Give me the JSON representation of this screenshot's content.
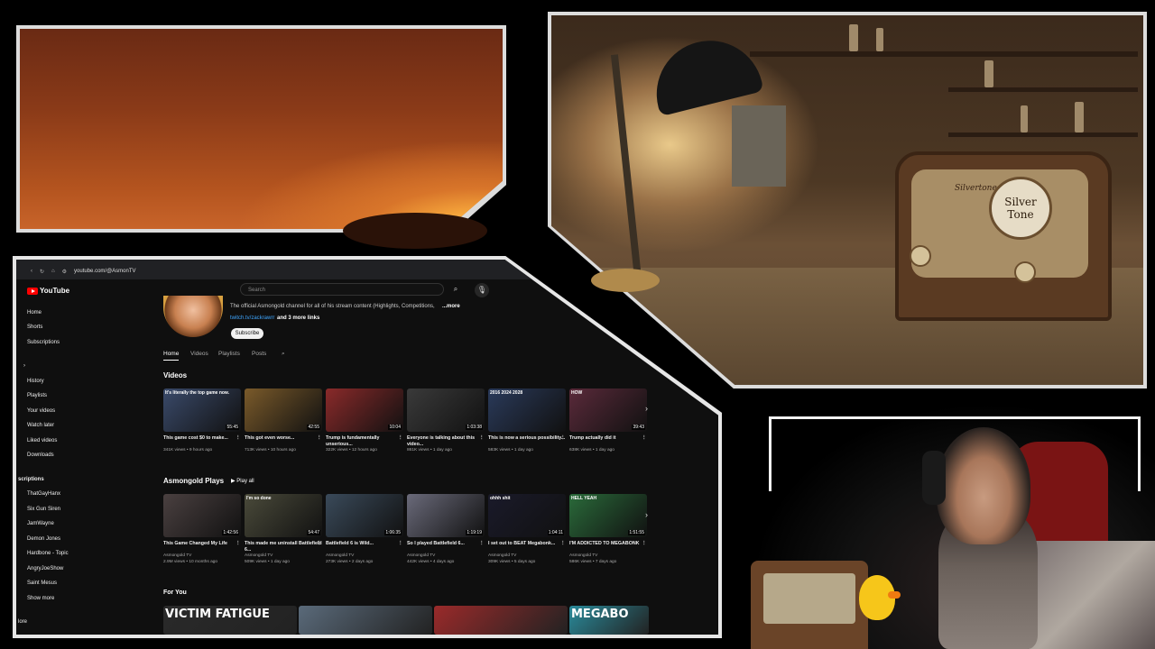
{
  "browser": {
    "url": "youtube.com/@AsmonTV"
  },
  "youtube": {
    "logo_text": "YouTube",
    "search_placeholder": "Search",
    "sidebar": {
      "top": [
        "Home",
        "Shorts",
        "Subscriptions"
      ],
      "you": [
        "History",
        "Playlists",
        "Your videos",
        "Watch later",
        "Liked videos",
        "Downloads"
      ],
      "subscriptions_header": "scriptions",
      "subscriptions": [
        "ThatGayHanx",
        "Six Gun Siren",
        "JamWayne",
        "Demon Jones",
        "Hardbone - Topic",
        "AngryJoeShow",
        "Saint Mesus",
        "Show more"
      ],
      "footer": "lore"
    },
    "channel": {
      "description": "The official Asmongold channel for all of his stream content (Highlights, Competitions,",
      "more": "...more",
      "links_prefix": "twitch.tv/zackrawrr",
      "links_suffix": "and 3 more links",
      "subscribe_label": "Subscribe"
    },
    "tabs": [
      "Home",
      "Videos",
      "Playlists",
      "Posts"
    ],
    "videos_section": {
      "title": "Videos",
      "items": [
        {
          "title": "This game cost $0 to make...",
          "meta": "341K views • 9 hours ago",
          "duration": "55:45",
          "overlay": "It's literally the top game now.",
          "bg": "#3a4a6a"
        },
        {
          "title": "This got even worse...",
          "meta": "713K views • 10 hours ago",
          "duration": "42:55",
          "overlay": "",
          "bg": "#7a5a2a"
        },
        {
          "title": "Trump is fundamentally unserious...",
          "meta": "322K views • 12 hours ago",
          "duration": "10:04",
          "overlay": "",
          "bg": "#8a2a2a"
        },
        {
          "title": "Everyone is talking about this video...",
          "meta": "861K views • 1 day ago",
          "duration": "1:03:38",
          "overlay": "",
          "bg": "#3a3a3a"
        },
        {
          "title": "This is now a serious possibility...",
          "meta": "583K views • 1 day ago",
          "duration": "",
          "overlay": "2016   2024   2028",
          "bg": "#2a3a5a"
        },
        {
          "title": "Trump actually did it",
          "meta": "638K views • 1 day ago",
          "duration": "39:43",
          "overlay": "HOW",
          "bg": "#5a2a3a"
        }
      ]
    },
    "plays_section": {
      "title": "Asmongold Plays",
      "play_all": "Play all",
      "items": [
        {
          "title": "This Game Changed My Life",
          "channel": "Asmongold TV",
          "meta": "2.9M views • 10 months ago",
          "duration": "1:42:56",
          "overlay": "",
          "bg": "#4a4040"
        },
        {
          "title": "This made me uninstall Battlefield 6...",
          "channel": "Asmongold TV",
          "meta": "509K views • 1 day ago",
          "duration": "54:47",
          "overlay": "I'm so done",
          "bg": "#4a4a3a"
        },
        {
          "title": "Battlefield 6 is Wild...",
          "channel": "Asmongold TV",
          "meta": "273K views • 2 days ago",
          "duration": "1:06:35",
          "overlay": "",
          "bg": "#3a4a5a"
        },
        {
          "title": "So I played Battlefield 6...",
          "channel": "Asmongold TV",
          "meta": "442K views • 4 days ago",
          "duration": "1:19:19",
          "overlay": "",
          "bg": "#6a6a7a"
        },
        {
          "title": "I set out to BEAT Megabonk...",
          "channel": "Asmongold TV",
          "meta": "309K views • 5 days ago",
          "duration": "1:04:11",
          "overlay": "ohhh shit",
          "bg": "#1a1a2a"
        },
        {
          "title": "I'M ADDICTED TO MEGABONK",
          "channel": "Asmongold TV",
          "meta": "586K views • 7 days ago",
          "duration": "1:51:55",
          "overlay": "HELL YEAH",
          "bg": "#2a6a3a"
        }
      ]
    },
    "for_you": {
      "title": "For You",
      "items": [
        {
          "overlay": "VICTIM FATIGUE",
          "bg": "#2a2a2a"
        },
        {
          "overlay": "",
          "bg": "#5a6a7a"
        },
        {
          "overlay": "",
          "bg": "#9a2a2a"
        },
        {
          "overlay": "MEGABO",
          "bg": "#2a8a9a"
        }
      ]
    }
  },
  "workshop": {
    "radio_brand": "Silvertone",
    "dial_text": "Silver Tone"
  }
}
